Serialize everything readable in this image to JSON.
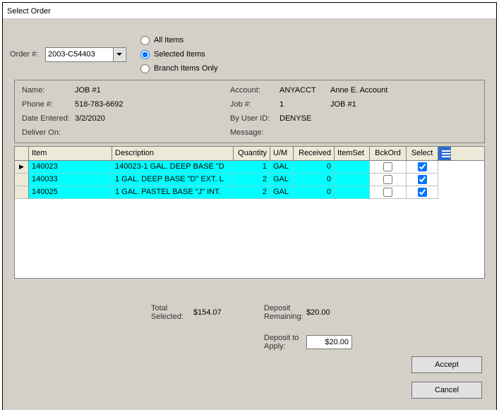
{
  "window": {
    "title": "Select Order"
  },
  "order": {
    "label": "Order #:",
    "value": "2003-C54403"
  },
  "filters": {
    "all": "All Items",
    "selected": "Selected Items",
    "branch": "Branch Items Only",
    "checked": "selected"
  },
  "info": {
    "name_lbl": "Name:",
    "name": "JOB #1",
    "phone_lbl": "Phone #:",
    "phone": "518-783-6692",
    "date_lbl": "Date Entered:",
    "date": "3/2/2020",
    "deliver_lbl": "Deliver On:",
    "deliver": "",
    "acct_lbl": "Account:",
    "acct": "ANYACCT",
    "acct_name": "Anne E. Account",
    "job_lbl": "Job #:",
    "job": "1",
    "job_name": "JOB #1",
    "user_lbl": "By User ID:",
    "user": "DENYSE",
    "msg_lbl": "Message:",
    "msg": ""
  },
  "grid": {
    "headers": {
      "item": "Item",
      "desc": "Description",
      "qty": "Quantity",
      "um": "U/M",
      "recv": "Received",
      "iset": "ItemSet",
      "bck": "BckOrd",
      "sel": "Select"
    },
    "rows": [
      {
        "item": "140023",
        "desc": "140023-1 GAL. DEEP BASE \"D",
        "qty": "1",
        "um": "GAL",
        "recv": "0",
        "iset": "",
        "bck": false,
        "sel": true
      },
      {
        "item": "140033",
        "desc": "1 GAL. DEEP BASE \"D\" EXT. L",
        "qty": "2",
        "um": "GAL",
        "recv": "0",
        "iset": "",
        "bck": false,
        "sel": true
      },
      {
        "item": "140025",
        "desc": "1 GAL. PASTEL BASE \"J\" INT.",
        "qty": "2",
        "um": "GAL",
        "recv": "0",
        "iset": "",
        "bck": false,
        "sel": true
      }
    ]
  },
  "totals": {
    "selected_lbl": "Total Selected:",
    "selected": "$154.07",
    "remain_lbl": "Deposit Remaining:",
    "remain": "$20.00",
    "apply_lbl": "Deposit to Apply:",
    "apply": "$20.00"
  },
  "buttons": {
    "accept": "Accept",
    "cancel": "Cancel"
  }
}
